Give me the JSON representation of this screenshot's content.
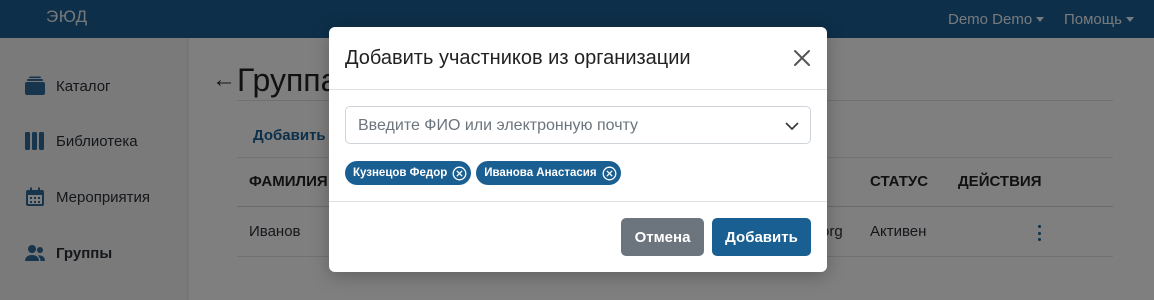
{
  "app": {
    "logo_text": "ЭЮД"
  },
  "topbar": {
    "user_menu": "Demo Demo",
    "help_menu": "Помощь"
  },
  "sidebar": {
    "items": [
      {
        "label": "Каталог",
        "icon": "catalog-icon"
      },
      {
        "label": "Библиотека",
        "icon": "library-icon"
      },
      {
        "label": "Мероприятия",
        "icon": "calendar-icon"
      },
      {
        "label": "Группы",
        "icon": "groups-icon",
        "active": true
      }
    ]
  },
  "main": {
    "title": "Группа",
    "add_link": "Добавить",
    "table": {
      "columns": [
        "ФАМИЛИЯ",
        "СТАТУС",
        "ДЕЙСТВИЯ"
      ],
      "rows": [
        {
          "surname": "Иванов",
          "email_tail": "org",
          "status": "Активен"
        }
      ]
    }
  },
  "modal": {
    "title": "Добавить участников из организации",
    "select_placeholder": "Введите ФИО или электронную почту",
    "chips": [
      "Кузнецов Федор",
      "Иванова Анастасия"
    ],
    "cancel_label": "Отмена",
    "submit_label": "Добавить"
  },
  "colors": {
    "brand": "#1a5f92",
    "secondary_button": "#6c757d",
    "overlay": "rgba(0,0,0,0.5)"
  }
}
